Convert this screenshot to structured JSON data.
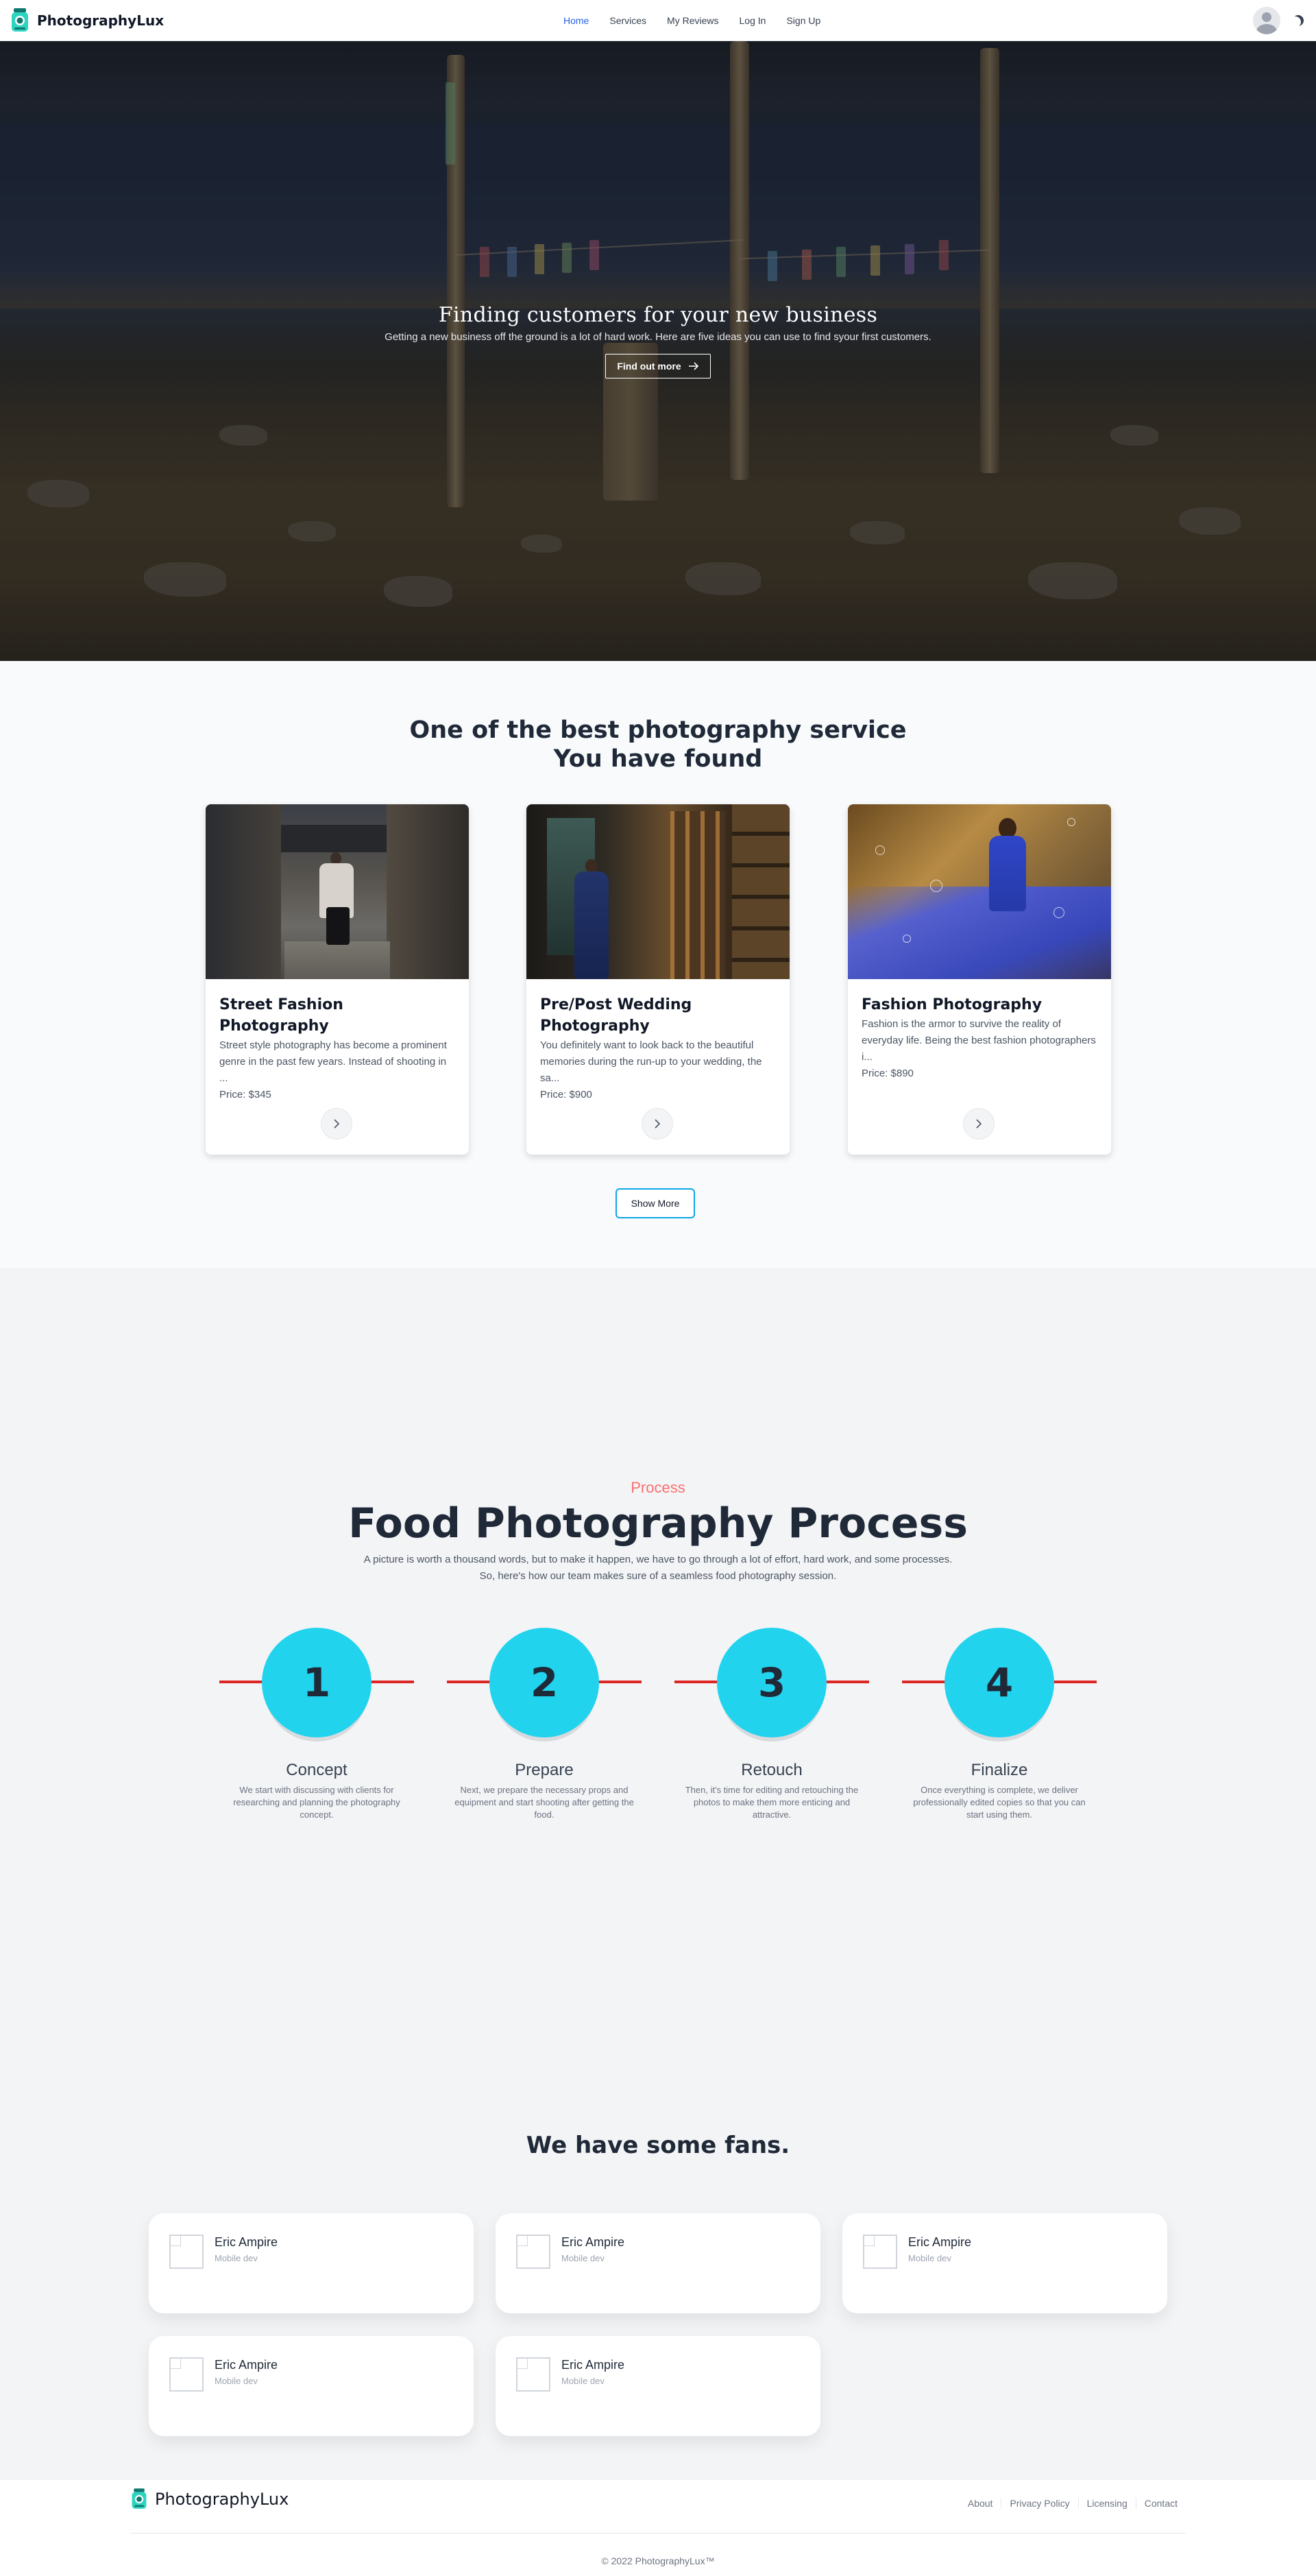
{
  "nav": {
    "brand": "PhotographyLux",
    "links": [
      {
        "label": "Home",
        "active": true
      },
      {
        "label": "Services"
      },
      {
        "label": "My Reviews"
      },
      {
        "label": "Log In"
      },
      {
        "label": "Sign Up"
      }
    ],
    "avatar_icon": "user-avatar-icon",
    "theme_icon": "moon-icon"
  },
  "hero": {
    "title": "Finding customers for your new business",
    "subtitle": "Getting a new business off the ground is a lot of hard work. Here are five ideas you can use to find syour first customers.",
    "button_label": "Find out more",
    "button_icon": "arrow-right-icon"
  },
  "services": {
    "title_line1": "One of the best photography service",
    "title_line2": "You have found",
    "cards": [
      {
        "title": "Street Fashion Photography",
        "description": "Street style photography has become a prominent genre in the past few years. Instead of shooting in ...",
        "price": "Price: $345"
      },
      {
        "title": "Pre/Post Wedding Photography",
        "description": "You definitely want to look back to the beautiful memories during the run-up to your wedding, the sa...",
        "price": "Price: $900"
      },
      {
        "title": "Fashion Photography",
        "description": "Fashion is the armor to survive the reality of everyday life. Being the best fashion photographers i...",
        "price": "Price: $890"
      }
    ],
    "show_more_label": "Show More"
  },
  "process": {
    "kicker": "Process",
    "title": "Food Photography Process",
    "description": "A picture is worth a thousand words, but to make it happen, we have to go through a lot of effort, hard work, and some processes. So, here's how our team makes sure of a seamless food photography session.",
    "steps": [
      {
        "number": "1",
        "title": "Concept",
        "description": "We start with discussing with clients for researching and planning the photography concept."
      },
      {
        "number": "2",
        "title": "Prepare",
        "description": "Next, we prepare the necessary props and equipment and start shooting after getting the food."
      },
      {
        "number": "3",
        "title": "Retouch",
        "description": "Then, it's time for editing and retouching the photos to make them more enticing and attractive."
      },
      {
        "number": "4",
        "title": "Finalize",
        "description": "Once everything is complete, we deliver professionally edited copies so that you can start using them."
      }
    ]
  },
  "fans": {
    "title": "We have some fans.",
    "items": [
      {
        "name": "Eric Ampire",
        "role": "Mobile dev"
      },
      {
        "name": "Eric Ampire",
        "role": "Mobile dev"
      },
      {
        "name": "Eric Ampire",
        "role": "Mobile dev"
      },
      {
        "name": "Eric Ampire",
        "role": "Mobile dev"
      },
      {
        "name": "Eric Ampire",
        "role": "Mobile dev"
      }
    ]
  },
  "footer": {
    "brand": "PhotographyLux",
    "links": [
      "About",
      "Privacy Policy",
      "Licensing",
      "Contact"
    ],
    "copyright": "© 2022 PhotographyLux™"
  },
  "colors": {
    "accent": "#2563eb",
    "process_circle": "#22d3ee",
    "process_line": "#dc2626",
    "kicker": "#f87171",
    "show_more_border": "#0ea5e9"
  }
}
